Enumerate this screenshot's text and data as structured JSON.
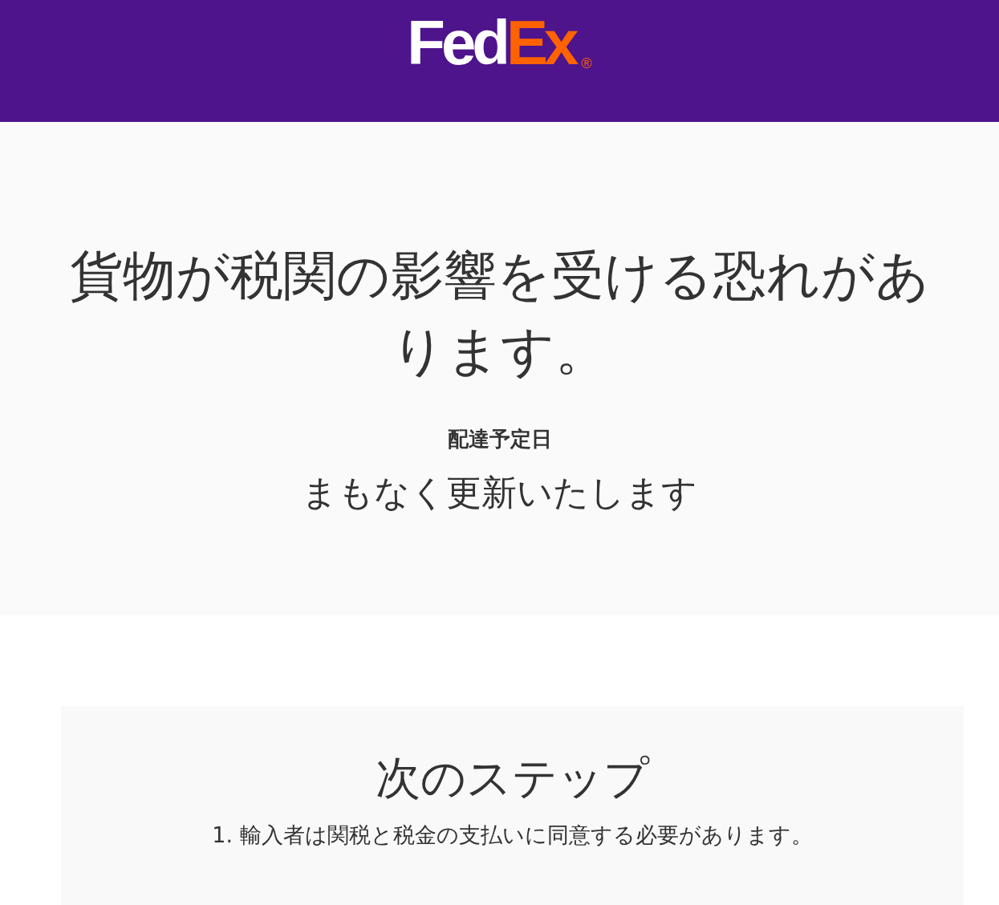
{
  "header": {
    "logo": {
      "text_1": "Fed",
      "text_2": "Ex",
      "registered": "®"
    }
  },
  "status": {
    "heading": "貨物が税関の影響を受ける恐れがあります。",
    "delivery_label": "配達予定日",
    "delivery_value": "まもなく更新いたします"
  },
  "next_steps": {
    "title": "次のステップ",
    "items": [
      "1. 輸入者は関税と税金の支払いに同意する必要があります。"
    ]
  }
}
